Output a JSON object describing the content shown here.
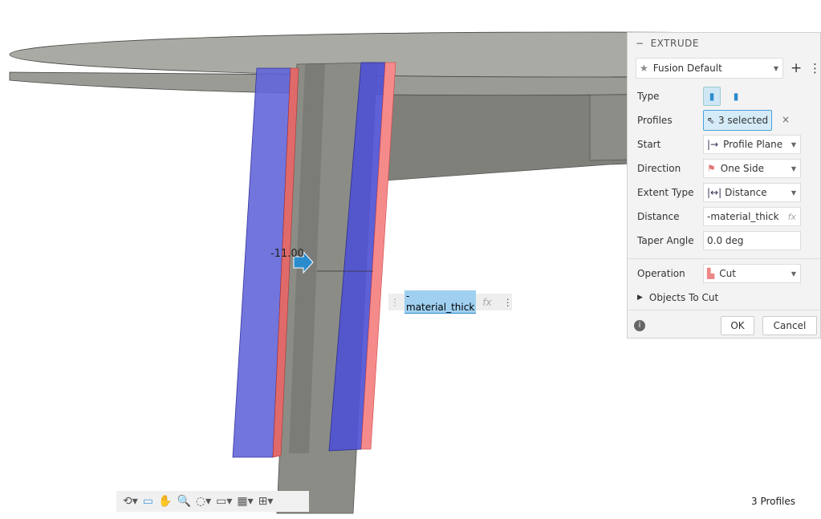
{
  "panel": {
    "title": "EXTRUDE",
    "preset": "Fusion Default",
    "rows": {
      "type": "Type",
      "profiles": "Profiles",
      "profiles_value": "3 selected",
      "start": "Start",
      "start_value": "Profile Plane",
      "direction": "Direction",
      "direction_value": "One Side",
      "extent": "Extent Type",
      "extent_value": "Distance",
      "distance": "Distance",
      "distance_value": "-material_thick",
      "taper": "Taper Angle",
      "taper_value": "0.0 deg",
      "operation": "Operation",
      "operation_value": "Cut",
      "objects": "Objects To Cut"
    },
    "fx": "fx",
    "ok": "OK",
    "cancel": "Cancel"
  },
  "viewport": {
    "dimension": "-11.00",
    "input_value": "-material_thick",
    "fx": "fx"
  },
  "status": "3 Profiles",
  "colors": {
    "body": "#8a8a85",
    "profile": "#5b5fd6",
    "cut": "#f07070",
    "accent": "#2a8ccc"
  }
}
